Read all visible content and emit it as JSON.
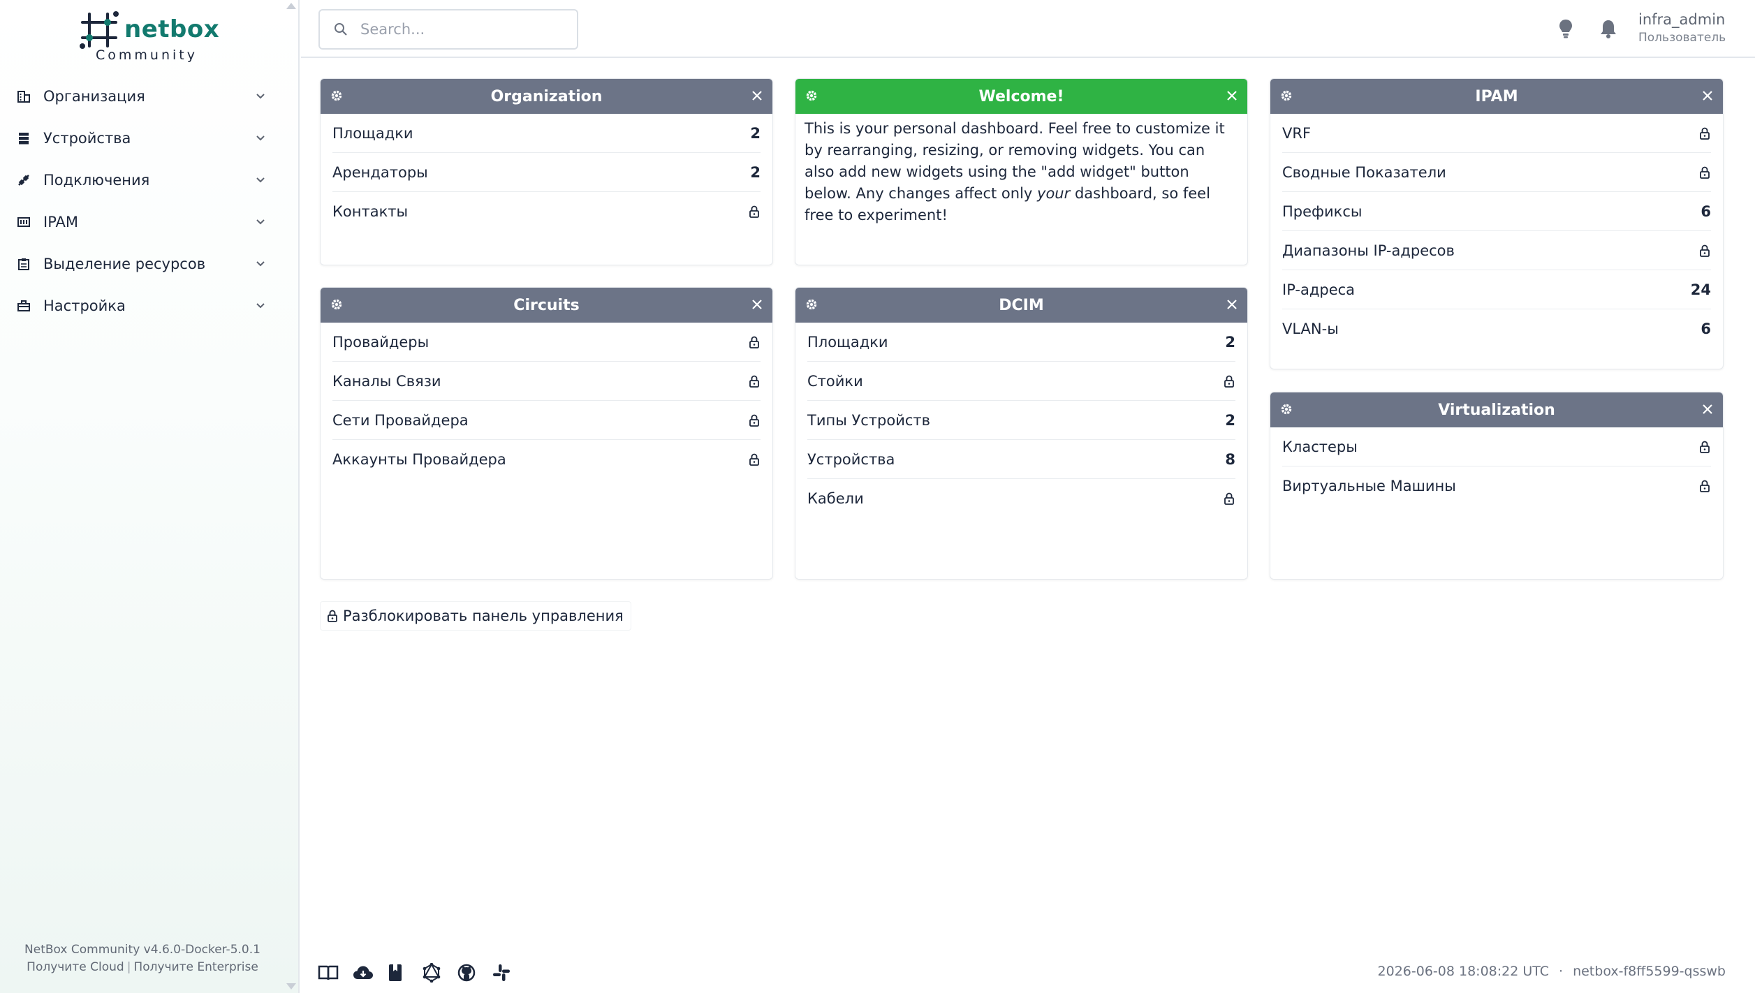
{
  "brand": {
    "name": "netbox",
    "edition": "Community",
    "color": "#127a6e"
  },
  "sidebar": {
    "items": [
      {
        "label": "Организация",
        "icon": "building-icon"
      },
      {
        "label": "Устройства",
        "icon": "server-icon"
      },
      {
        "label": "Подключения",
        "icon": "connection-icon"
      },
      {
        "label": "IPAM",
        "icon": "counter-icon"
      },
      {
        "label": "Выделение ресурсов",
        "icon": "clipboard-icon"
      },
      {
        "label": "Настройка",
        "icon": "toolbox-icon"
      }
    ],
    "footer": {
      "version": "NetBox Community v4.6.0-Docker-5.0.1",
      "cloud_link": "Получите Cloud",
      "separator": "|",
      "enterprise_link": "Получите Enterprise"
    }
  },
  "header": {
    "search_placeholder": "Search...",
    "user": {
      "name": "infra_admin",
      "role": "Пользователь"
    }
  },
  "widgets": {
    "organization": {
      "title": "Organization",
      "rows": [
        {
          "label": "Площадки",
          "count": "2"
        },
        {
          "label": "Арендаторы",
          "count": "2"
        },
        {
          "label": "Контакты",
          "locked": true
        }
      ]
    },
    "welcome": {
      "title": "Welcome!",
      "text_before": "This is your personal dashboard. Feel free to customize it by rearranging, resizing, or removing widgets. You can also add new widgets using the \"add widget\" button below. Any changes affect only ",
      "text_em": "your",
      "text_after": " dashboard, so feel free to experiment!"
    },
    "ipam": {
      "title": "IPAM",
      "rows": [
        {
          "label": "VRF",
          "locked": true
        },
        {
          "label": "Сводные Показатели",
          "locked": true
        },
        {
          "label": "Префиксы",
          "count": "6"
        },
        {
          "label": "Диапазоны IP-адресов",
          "locked": true
        },
        {
          "label": "IP-адреса",
          "count": "24"
        },
        {
          "label": "VLAN-ы",
          "count": "6"
        }
      ]
    },
    "circuits": {
      "title": "Circuits",
      "rows": [
        {
          "label": "Провайдеры",
          "locked": true
        },
        {
          "label": "Каналы Связи",
          "locked": true
        },
        {
          "label": "Сети Провайдера",
          "locked": true
        },
        {
          "label": "Аккаунты Провайдера",
          "locked": true
        }
      ]
    },
    "dcim": {
      "title": "DCIM",
      "rows": [
        {
          "label": "Площадки",
          "count": "2"
        },
        {
          "label": "Стойки",
          "locked": true
        },
        {
          "label": "Типы Устройств",
          "count": "2"
        },
        {
          "label": "Устройства",
          "count": "8"
        },
        {
          "label": "Кабели",
          "locked": true
        }
      ]
    },
    "virtualization": {
      "title": "Virtualization",
      "rows": [
        {
          "label": "Кластеры",
          "locked": true
        },
        {
          "label": "Виртуальные Машины",
          "locked": true
        }
      ]
    }
  },
  "unlock_button": "Разблокировать панель управления",
  "footer": {
    "icons": [
      "book-icon",
      "cloud-icon",
      "bookmark-icon",
      "graphql-icon",
      "github-icon",
      "slack-icon"
    ],
    "timestamp": "2026-06-08 18:08:22 UTC",
    "dot": "·",
    "hostname": "netbox-f8ff5599-qsswb"
  },
  "colors": {
    "widget_header": "#6c7487",
    "welcome_header": "#2fb344",
    "text": "#1d273b"
  }
}
